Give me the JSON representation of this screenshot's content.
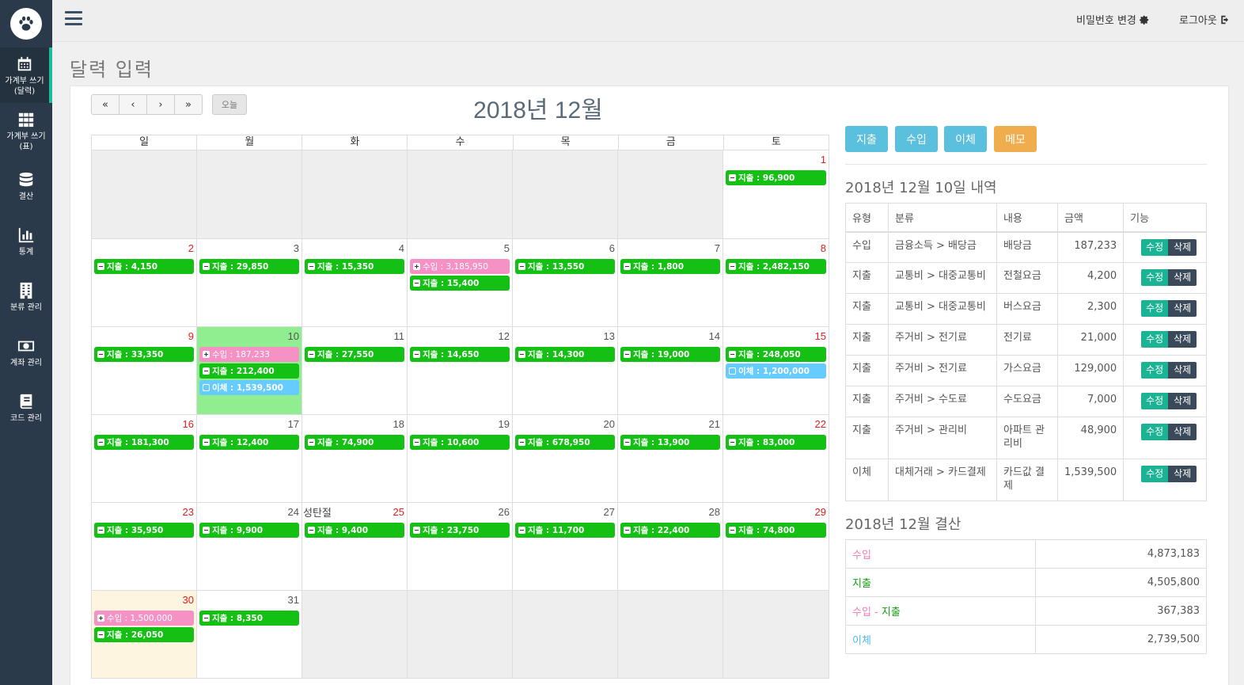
{
  "sidebar": {
    "items": [
      {
        "label": "가계부 쓰기\n(달력)",
        "icon": "calendar-icon"
      },
      {
        "label": "가계부 쓰기\n(표)",
        "icon": "grid-icon"
      },
      {
        "label": "결산",
        "icon": "database-icon"
      },
      {
        "label": "통계",
        "icon": "bar-chart-icon"
      },
      {
        "label": "분류 관리",
        "icon": "building-icon"
      },
      {
        "label": "계좌 관리",
        "icon": "money-icon"
      },
      {
        "label": "코드 관리",
        "icon": "book-icon"
      }
    ]
  },
  "topbar": {
    "change_password": "비밀번호 변경",
    "logout": "로그아웃"
  },
  "page_title": "달력 입력",
  "calendar": {
    "title": "2018년 12월",
    "nav": [
      "«",
      "‹",
      "›",
      "»"
    ],
    "today_label": "오늘",
    "weekdays": [
      "일",
      "월",
      "화",
      "수",
      "목",
      "금",
      "토"
    ],
    "weeks": [
      [
        {
          "day": ""
        },
        {
          "day": ""
        },
        {
          "day": ""
        },
        {
          "day": ""
        },
        {
          "day": ""
        },
        {
          "day": ""
        },
        {
          "day": "1",
          "events": [
            {
              "kind": "out",
              "text": "지출 : 96,900"
            }
          ]
        }
      ],
      [
        {
          "day": "2",
          "events": [
            {
              "kind": "out",
              "text": "지출 : 4,150"
            }
          ]
        },
        {
          "day": "3",
          "events": [
            {
              "kind": "out",
              "text": "지출 : 29,850"
            }
          ]
        },
        {
          "day": "4",
          "events": [
            {
              "kind": "out",
              "text": "지출 : 15,350"
            }
          ]
        },
        {
          "day": "5",
          "events": [
            {
              "kind": "in",
              "text": "수입 : 3,185,950"
            },
            {
              "kind": "out",
              "text": "지출 : 15,400"
            }
          ]
        },
        {
          "day": "6",
          "events": [
            {
              "kind": "out",
              "text": "지출 : 13,550"
            }
          ]
        },
        {
          "day": "7",
          "events": [
            {
              "kind": "out",
              "text": "지출 : 1,800"
            }
          ]
        },
        {
          "day": "8",
          "events": [
            {
              "kind": "out",
              "text": "지출 : 2,482,150"
            }
          ]
        }
      ],
      [
        {
          "day": "9",
          "events": [
            {
              "kind": "out",
              "text": "지출 : 33,350"
            }
          ]
        },
        {
          "day": "10",
          "today": true,
          "events": [
            {
              "kind": "in",
              "text": "수입 : 187,233"
            },
            {
              "kind": "out",
              "text": "지출 : 212,400"
            },
            {
              "kind": "tr",
              "text": "이체 : 1,539,500"
            }
          ]
        },
        {
          "day": "11",
          "events": [
            {
              "kind": "out",
              "text": "지출 : 27,550"
            }
          ]
        },
        {
          "day": "12",
          "events": [
            {
              "kind": "out",
              "text": "지출 : 14,650"
            }
          ]
        },
        {
          "day": "13",
          "events": [
            {
              "kind": "out",
              "text": "지출 : 14,300"
            }
          ]
        },
        {
          "day": "14",
          "events": [
            {
              "kind": "out",
              "text": "지출 : 19,000"
            }
          ]
        },
        {
          "day": "15",
          "events": [
            {
              "kind": "out",
              "text": "지출 : 248,050"
            },
            {
              "kind": "tr",
              "text": "이체 : 1,200,000"
            }
          ]
        }
      ],
      [
        {
          "day": "16",
          "events": [
            {
              "kind": "out",
              "text": "지출 : 181,300"
            }
          ]
        },
        {
          "day": "17",
          "events": [
            {
              "kind": "out",
              "text": "지출 : 12,400"
            }
          ]
        },
        {
          "day": "18",
          "events": [
            {
              "kind": "out",
              "text": "지출 : 74,900"
            }
          ]
        },
        {
          "day": "19",
          "events": [
            {
              "kind": "out",
              "text": "지출 : 10,600"
            }
          ]
        },
        {
          "day": "20",
          "events": [
            {
              "kind": "out",
              "text": "지출 : 678,950"
            }
          ]
        },
        {
          "day": "21",
          "events": [
            {
              "kind": "out",
              "text": "지출 : 13,900"
            }
          ]
        },
        {
          "day": "22",
          "events": [
            {
              "kind": "out",
              "text": "지출 : 83,000"
            }
          ]
        }
      ],
      [
        {
          "day": "23",
          "events": [
            {
              "kind": "out",
              "text": "지출 : 35,950"
            }
          ]
        },
        {
          "day": "24",
          "events": [
            {
              "kind": "out",
              "text": "지출 : 9,900"
            }
          ]
        },
        {
          "day": "25",
          "holiday": "성탄절",
          "events": [
            {
              "kind": "out",
              "text": "지출 : 9,400"
            }
          ]
        },
        {
          "day": "26",
          "events": [
            {
              "kind": "out",
              "text": "지출 : 23,750"
            }
          ]
        },
        {
          "day": "27",
          "events": [
            {
              "kind": "out",
              "text": "지출 : 11,700"
            }
          ]
        },
        {
          "day": "28",
          "events": [
            {
              "kind": "out",
              "text": "지출 : 22,400"
            }
          ]
        },
        {
          "day": "29",
          "events": [
            {
              "kind": "out",
              "text": "지출 : 74,800"
            }
          ]
        }
      ],
      [
        {
          "day": "30",
          "highlight": true,
          "events": [
            {
              "kind": "in",
              "text": "수입 : 1,500,000"
            },
            {
              "kind": "out",
              "text": "지출 : 26,050"
            }
          ]
        },
        {
          "day": "31",
          "events": [
            {
              "kind": "out",
              "text": "지출 : 8,350"
            }
          ]
        },
        {
          "day": ""
        },
        {
          "day": ""
        },
        {
          "day": ""
        },
        {
          "day": ""
        },
        {
          "day": ""
        }
      ]
    ]
  },
  "actions": {
    "expense": "지출",
    "income": "수입",
    "transfer": "이체",
    "memo": "메모",
    "colors": {
      "info": "#5bc0de",
      "warning": "#f0ad4e"
    }
  },
  "detail": {
    "title": "2018년 12월 10일 내역",
    "headers": [
      "유형",
      "분류",
      "내용",
      "금액",
      "기능"
    ],
    "edit_label": "수정",
    "delete_label": "삭제",
    "rows": [
      {
        "type": "수입",
        "kind": "in",
        "category": "금융소득 > 배당금",
        "content": "배당금",
        "amount": "187,233"
      },
      {
        "type": "지출",
        "kind": "out",
        "category": "교통비 > 대중교통비",
        "content": "전철요금",
        "amount": "4,200"
      },
      {
        "type": "지출",
        "kind": "out",
        "category": "교통비 > 대중교통비",
        "content": "버스요금",
        "amount": "2,300"
      },
      {
        "type": "지출",
        "kind": "out",
        "category": "주거비 > 전기료",
        "content": "전기료",
        "amount": "21,000"
      },
      {
        "type": "지출",
        "kind": "out",
        "category": "주거비 > 전기료",
        "content": "가스요금",
        "amount": "129,000"
      },
      {
        "type": "지출",
        "kind": "out",
        "category": "주거비 > 수도료",
        "content": "수도요금",
        "amount": "7,000"
      },
      {
        "type": "지출",
        "kind": "out",
        "category": "주거비 > 관리비",
        "content": "아파트 관리비",
        "amount": "48,900"
      },
      {
        "type": "이체",
        "kind": "tr",
        "category": "대체거래 > 카드결제",
        "content": "카드값 결제",
        "amount": "1,539,500"
      }
    ]
  },
  "summary": {
    "title": "2018년 12월 결산",
    "income_label": "수입",
    "income": "4,873,183",
    "expense_label": "지출",
    "expense": "4,505,800",
    "diff_dash": " - ",
    "diff": "367,383",
    "transfer_label": "이체",
    "transfer": "2,739,500"
  }
}
